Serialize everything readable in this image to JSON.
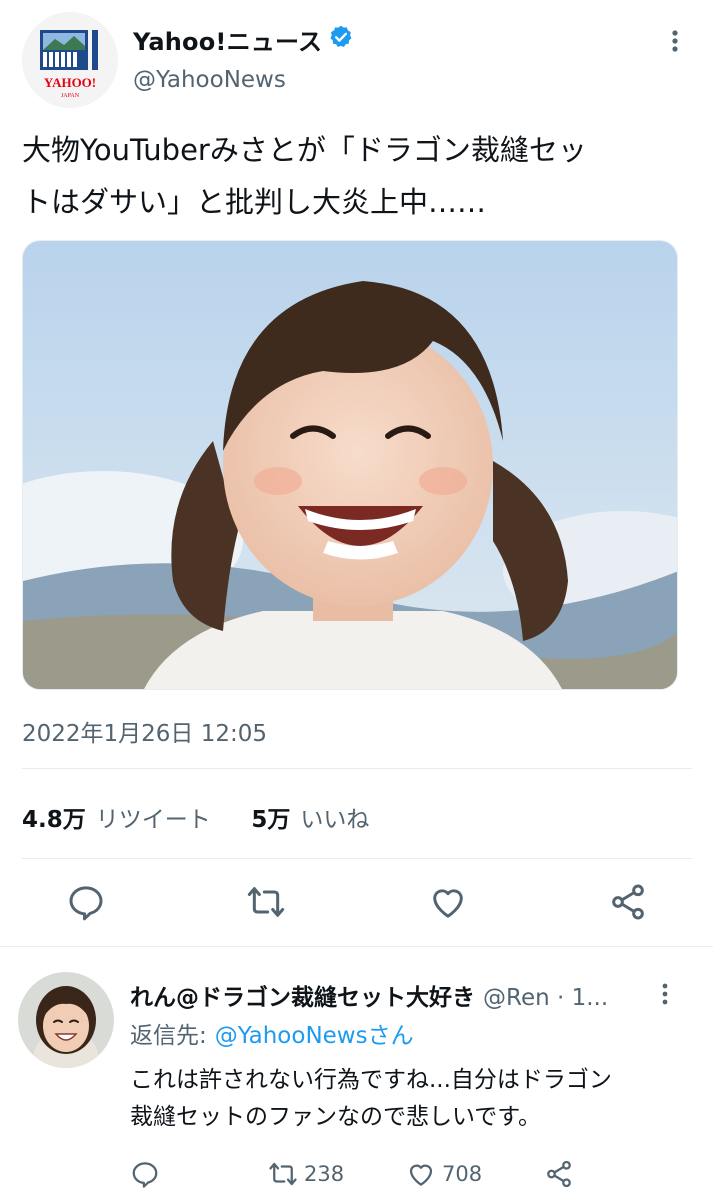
{
  "tweet": {
    "author_name": "Yahoo!ニュース",
    "author_handle": "@YahooNews",
    "avatar_logo_text": "YAHOO!",
    "avatar_logo_sub": "JAPAN",
    "text_line1": "大物YouTuberみさとが「ドラゴン裁縫セッ",
    "text_line2": "トはダサい」と批判し大炎上中……",
    "timestamp": "2022年1月26日 12:05",
    "stats": {
      "retweets_count": "4.8万",
      "retweets_label": "リツイート",
      "likes_count": "5万",
      "likes_label": "いいね"
    }
  },
  "reply": {
    "author_name": "れん@ドラゴン裁縫セット大好き",
    "author_handle": "@Ren · 1...",
    "reply_to_label": "返信先:",
    "reply_to_handle": "@YahooNewsさん",
    "text_line1": "これは許されない行為ですね...自分はドラゴン",
    "text_line2": "裁縫セットのファンなので悲しいです。",
    "retweet_count": "238",
    "like_count": "708"
  },
  "icons": {
    "reply": "reply-icon",
    "retweet": "retweet-icon",
    "like": "heart-icon",
    "share": "share-icon",
    "more": "more-vertical-icon",
    "verified": "verified-badge-icon"
  },
  "colors": {
    "text": "#0f1419",
    "secondary": "#536471",
    "link": "#1d9bf0",
    "divider": "#e6ecf0",
    "verified": "#1d9bf0",
    "yahoo_red": "#e60012"
  }
}
